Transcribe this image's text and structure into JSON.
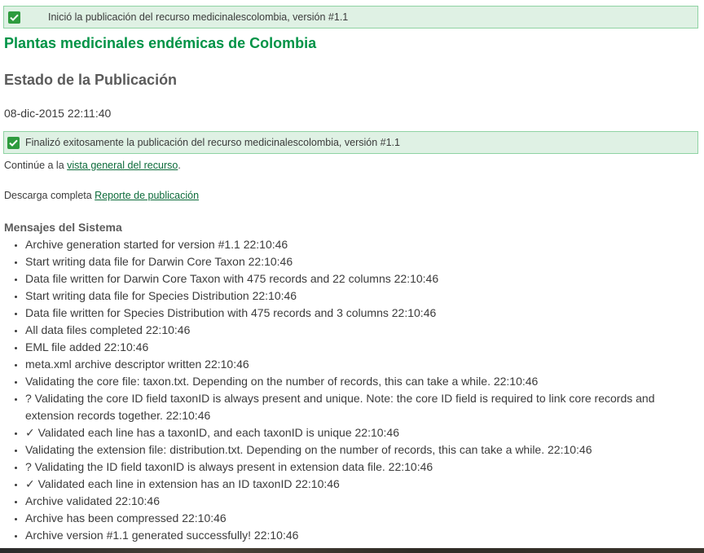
{
  "top_alert": {
    "text": "Inició la publicación del recurso medicinalescolombia, versión #1.1",
    "icon": "check-icon"
  },
  "resource_title": "Plantas medicinales endémicas de Colombia",
  "section_title": "Estado de la Publicación",
  "timestamp": "08-dic-2015 22:11:40",
  "success_alert": {
    "text": "Finalizó exitosamente la publicación del recurso medicinalescolombia, versión #1.1",
    "icon": "check-icon"
  },
  "continue": {
    "prefix": "Continúe a la ",
    "link_text": "vista general del recurso",
    "suffix": "."
  },
  "download": {
    "prefix": "Descarga completa ",
    "link_text": "Reporte de publicación"
  },
  "messages": {
    "heading": "Mensajes del Sistema",
    "items": [
      "Archive generation started for version #1.1 22:10:46",
      "Start writing data file for Darwin Core Taxon 22:10:46",
      "Data file written for Darwin Core Taxon with 475 records and 22 columns 22:10:46",
      "Start writing data file for Species Distribution 22:10:46",
      "Data file written for Species Distribution with 475 records and 3 columns 22:10:46",
      "All data files completed 22:10:46",
      "EML file added 22:10:46",
      "meta.xml archive descriptor written 22:10:46",
      "Validating the core file: taxon.txt. Depending on the number of records, this can take a while. 22:10:46",
      "? Validating the core ID field taxonID is always present and unique. Note: the core ID field is required to link core records and extension records together. 22:10:46",
      "✓ Validated each line has a taxonID, and each taxonID is unique 22:10:46",
      "Validating the extension file: distribution.txt. Depending on the number of records, this can take a while. 22:10:46",
      "? Validating the ID field taxonID is always present in extension data file. 22:10:46",
      "✓ Validated each line in extension has an ID taxonID 22:10:46",
      "Archive validated 22:10:46",
      "Archive has been compressed 22:10:46",
      "Archive version #1.1 generated successfully! 22:10:46"
    ]
  },
  "colors": {
    "alert_bg": "#dff1e4",
    "alert_border": "#8fd3a3",
    "check_green": "#2e9b3e",
    "title_green": "#009346",
    "link_green": "#0c6b3a",
    "heading_gray": "#5b5b5b"
  }
}
